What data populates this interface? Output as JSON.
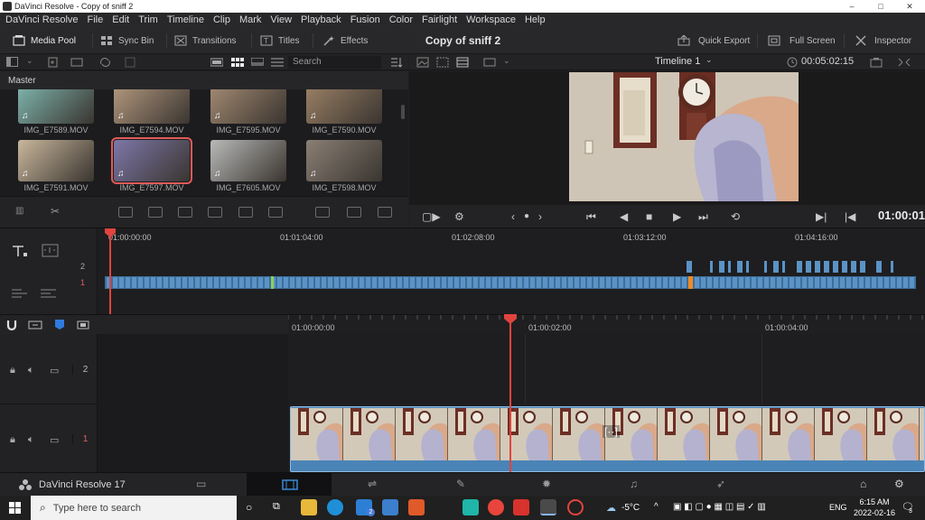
{
  "window": {
    "title": "DaVinci Resolve - Copy of sniff 2",
    "minimize": "–",
    "maximize": "□",
    "close": "✕"
  },
  "menu": [
    "DaVinci Resolve",
    "File",
    "Edit",
    "Trim",
    "Timeline",
    "Clip",
    "Mark",
    "View",
    "Playback",
    "Fusion",
    "Color",
    "Fairlight",
    "Workspace",
    "Help"
  ],
  "toolbar": {
    "media_pool": "Media Pool",
    "sync_bin": "Sync Bin",
    "transitions": "Transitions",
    "titles": "Titles",
    "effects": "Effects",
    "project_title": "Copy of sniff 2",
    "quick_export": "Quick Export",
    "full_screen": "Full Screen",
    "inspector": "Inspector"
  },
  "media_pool": {
    "search_placeholder": "Search",
    "bin_name": "Master",
    "clips": [
      {
        "name": "IMG_E7589.MOV",
        "selected": false,
        "color": "#7fb8b0"
      },
      {
        "name": "IMG_E7594.MOV",
        "selected": false,
        "color": "#b59a80"
      },
      {
        "name": "IMG_E7595.MOV",
        "selected": false,
        "color": "#a58c74"
      },
      {
        "name": "IMG_E7590.MOV",
        "selected": false,
        "color": "#9d8266"
      },
      {
        "name": "IMG_E7591.MOV",
        "selected": false,
        "color": "#c9b79c"
      },
      {
        "name": "IMG_E7597.MOV",
        "selected": true,
        "color": "#7d77a8"
      },
      {
        "name": "IMG_E7605.MOV",
        "selected": false,
        "color": "#b8b9b8"
      },
      {
        "name": "IMG_E7598.MOV",
        "selected": false,
        "color": "#8a7f74"
      }
    ]
  },
  "viewer": {
    "timeline_name": "Timeline 1",
    "timecode_top": "00:05:02:15",
    "timecode_current": "01:00:01"
  },
  "upper_timeline": {
    "ticks": [
      "01:00:00:00",
      "01:01:04:00",
      "01:02:08:00",
      "01:03:12:00",
      "01:04:16:00"
    ],
    "tracks": [
      "2",
      "1"
    ]
  },
  "lower_timeline": {
    "ticks": [
      "01:00:00:00",
      "01:00:02:00",
      "01:00:04:00"
    ],
    "tracks": [
      "2",
      "1"
    ]
  },
  "pagebar": {
    "app_name": "DaVinci Resolve 17"
  },
  "taskbar": {
    "search_placeholder": "Type here to search",
    "weather": "-5°C",
    "language": "ENG",
    "time": "6:15 AM",
    "date": "2022-02-16",
    "mail_badge": "2",
    "notif_badge": "3"
  },
  "colors": {
    "accent_red": "#e0443e",
    "clip_blue": "#4a84b7",
    "marker_orange": "#f08a24"
  }
}
